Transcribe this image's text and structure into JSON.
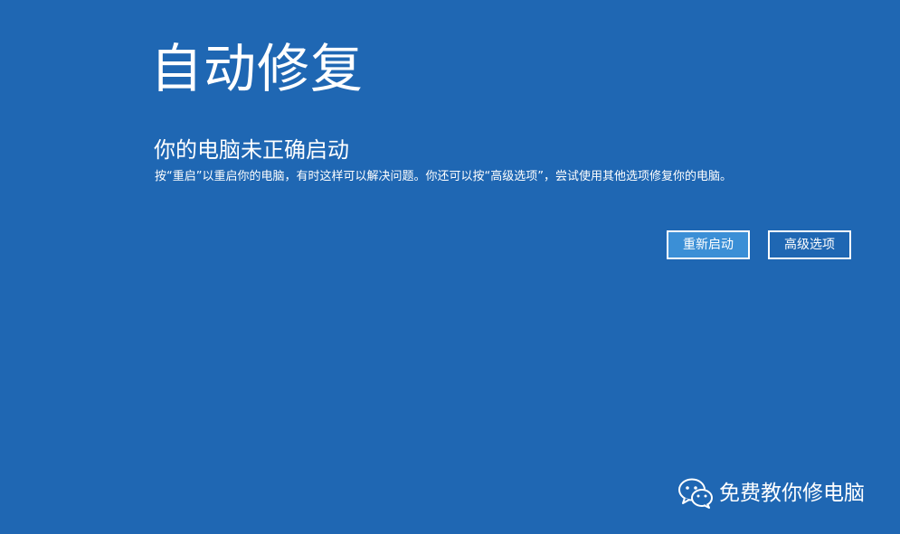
{
  "screen": {
    "background_color": "#1f67b3",
    "title": "自动修复",
    "subtitle": "你的电脑未正确启动",
    "description": "按“重启”以重启你的电脑，有时这样可以解决问题。你还可以按“高级选项”，尝试使用其他选项修复你的电脑。"
  },
  "buttons": {
    "restart_label": "重新启动",
    "restart_color": "#3b8fd6",
    "advanced_label": "高级选项"
  },
  "watermark": {
    "icon": "wechat-icon",
    "text": "免费教你修电脑"
  }
}
